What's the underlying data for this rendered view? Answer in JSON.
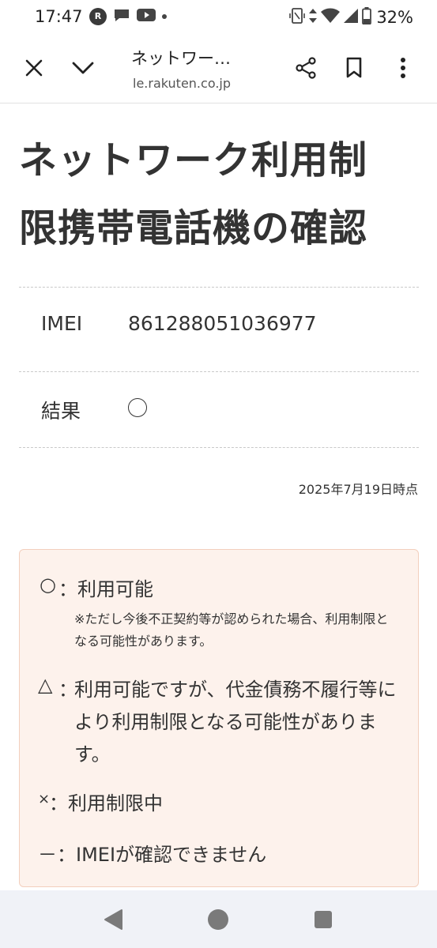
{
  "status_bar": {
    "time": "17:47",
    "rakuten_icon_text": "R",
    "battery": "32%",
    "icons": [
      "rakuten-icon",
      "chat-icon",
      "youtube-icon",
      "vibrate-icon",
      "data-arrows-icon",
      "wifi-icon",
      "signal-icon",
      "battery-icon"
    ]
  },
  "browser": {
    "tab_title": "ネットワー…",
    "url": "le.rakuten.co.jp",
    "buttons": [
      "close-icon",
      "chevron-down-icon",
      "share-icon",
      "bookmark-icon",
      "more-icon"
    ]
  },
  "page": {
    "title_line1": "ネットワーク利用制",
    "title_line2": "限携帯電話機の確認",
    "imei_label": "IMEI",
    "imei_value": "861288051036977",
    "result_label": "結果",
    "result_symbol": "○",
    "as_of": "2025年7月19日時点"
  },
  "legend": {
    "available_symbol": "○",
    "available_text": "：利用可能",
    "available_note": "※ただし今後不正契約等が認められた場合、利用制限となる可能性があります。",
    "triangle_symbol": "△",
    "triangle_colon": "：",
    "triangle_text": "利用可能ですが、代金債務不履行等により利用制限となる可能性があります。",
    "cross_symbol": "×",
    "cross_text": "：利用制限中",
    "dash_symbol": "－",
    "dash_text": "：IMEIが確認できません"
  },
  "colors": {
    "legend_background": "#fdf2ec",
    "legend_border": "#f3cfbd",
    "nav_background": "#f0f2f7"
  }
}
